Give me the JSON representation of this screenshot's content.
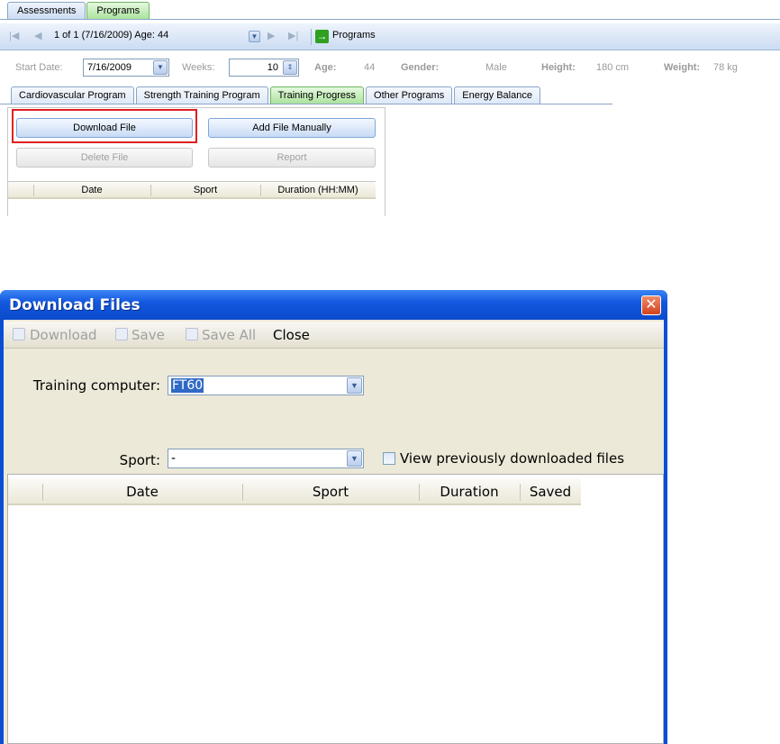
{
  "app": {
    "top_tabs": [
      {
        "label": "Assessments",
        "active": false
      },
      {
        "label": "Programs",
        "active": true
      }
    ],
    "navigator": {
      "record_text": "1 of 1 (7/16/2009) Age: 44",
      "go_label": "Programs"
    },
    "info": {
      "start_date_label": "Start Date:",
      "start_date_value": "7/16/2009",
      "weeks_label": "Weeks:",
      "weeks_value": "10",
      "age_label": "Age:",
      "age_value": "44",
      "gender_label": "Gender:",
      "gender_value": "Male",
      "height_label": "Height:",
      "height_value": "180 cm",
      "weight_label": "Weight:",
      "weight_value": "78 kg"
    },
    "program_tabs": [
      {
        "label": "Cardiovascular Program",
        "active": false
      },
      {
        "label": "Strength Training Program",
        "active": false
      },
      {
        "label": "Training Progress",
        "active": true
      },
      {
        "label": "Other Programs",
        "active": false
      },
      {
        "label": "Energy Balance",
        "active": false
      }
    ],
    "training_progress": {
      "download_file": "Download File",
      "add_file_manually": "Add File Manually",
      "delete_file": "Delete File",
      "report": "Report",
      "columns": [
        "Date",
        "Sport",
        "Duration (HH:MM)"
      ]
    }
  },
  "dialog": {
    "title": "Download Files",
    "toolbar": {
      "download": "Download",
      "save": "Save",
      "save_all": "Save All",
      "close": "Close"
    },
    "training_computer_label": "Training computer:",
    "training_computer_value": "FT60",
    "sport_label": "Sport:",
    "sport_value": "-",
    "view_previous_label": "View previously downloaded files",
    "view_previous_checked": false,
    "columns": [
      "Date",
      "Sport",
      "Duration",
      "Saved"
    ]
  },
  "colors": {
    "highlight_red": "#e02020",
    "active_tab_green": "#a8e29a",
    "title_bar_blue": "#0a4acb"
  }
}
